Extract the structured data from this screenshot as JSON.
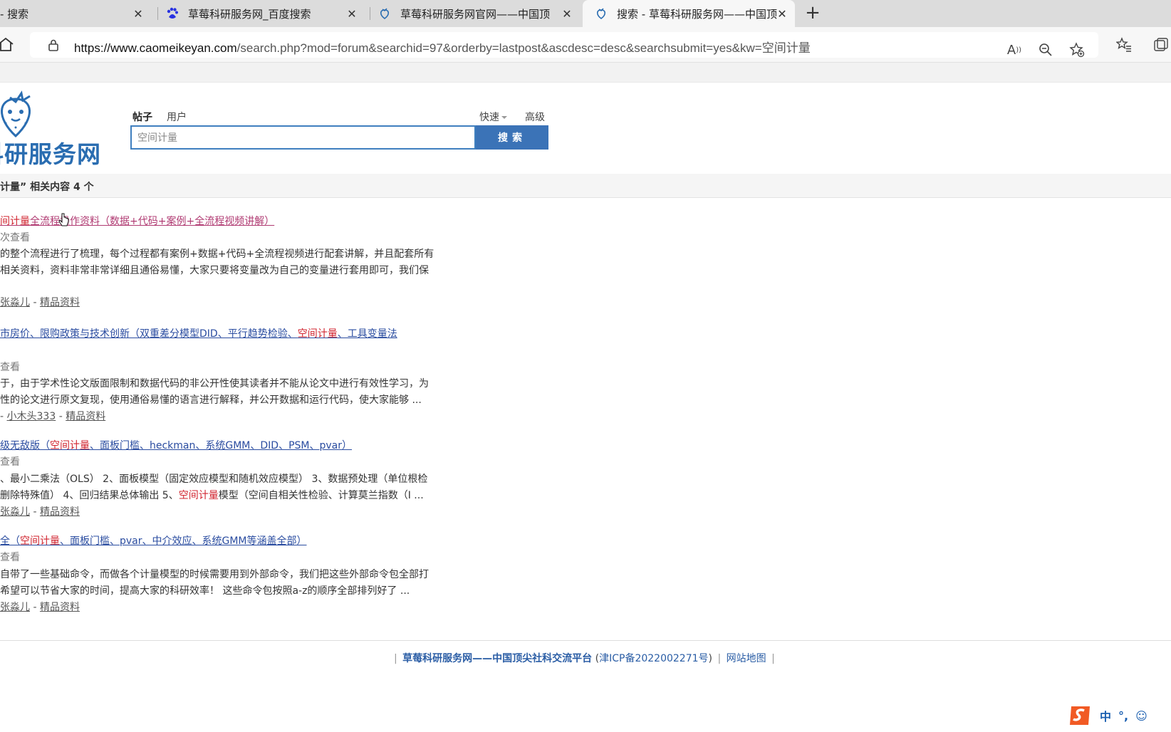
{
  "browser": {
    "tabs": [
      {
        "label": "- 搜索",
        "icon": "page-icon"
      },
      {
        "label": "草莓科研服务网_百度搜索",
        "icon": "baidu-paw-icon"
      },
      {
        "label": "草莓科研服务网官网——中国顶",
        "icon": "strawberry-icon"
      },
      {
        "label": "搜索 - 草莓科研服务网——中国顶",
        "icon": "strawberry-icon",
        "active": true
      }
    ],
    "address": {
      "host": "https://www.caomeikeyan.com",
      "path": "/search.php?mod=forum&searchid=97&orderby=lastpost&ascdesc=desc&searchsubmit=yes&kw=空间计量"
    }
  },
  "header": {
    "logo_text": "科研服务网",
    "search_types": [
      "帖子",
      "用户"
    ],
    "quick_label": "快速",
    "advanced_label": "高级",
    "search_value": "空间计量",
    "search_button": "搜索"
  },
  "summary": "计量” 相关内容 4 个",
  "results": [
    {
      "title_hl": "间计量",
      "title_rest": "全流程操作资料（数据+代码+案例+全流程视频讲解）",
      "meta": "次查看",
      "line1": "的整个流程进行了梳理，每个过程都有案例+数据+代码+全流程视频进行配套讲解，并且配套所有",
      "line2": "相关资料，资料非常非常详细且通俗易懂，大家只要将变量改为自己的变量进行套用即可，我们保",
      "author": "张淼儿",
      "category": "精品资料"
    },
    {
      "title_pre": "市房价、限购政策与技术创新（双重差分模型DID、平行趋势检验、",
      "title_hl": "空间计量",
      "title_post": "、工具变量法",
      "meta": "查看",
      "line1": "于，由于学术性论文版面限制和数据代码的非公开性使其读者并不能从论文中进行有效性学习，为",
      "line2": "性的论文进行原文复现，使用通俗易懂的语言进行解释，并公开数据和运行代码，使大家能够 ...",
      "author": "小木头333",
      "category": "精品资料"
    },
    {
      "title_pre": "级无敌版（",
      "title_hl": "空间计量",
      "title_post": "、面板门槛、heckman、系统GMM、DID、PSM、pvar）",
      "meta": "查看",
      "line1": "、最小二乘法（OLS） 2、面板模型（固定效应模型和随机效应模型） 3、数据预处理（单位根检",
      "line2_pre": "删除特殊值） 4、回归结果总体输出 5、",
      "line2_hl": "空间计量",
      "line2_post": "模型（空间自相关性检验、计算莫兰指数（I ...",
      "author": "张淼儿",
      "category": "精品资料"
    },
    {
      "title_pre": "全（",
      "title_hl": "空间计量",
      "title_post": "、面板门槛、pvar、中介效应、系统GMM等涵盖全部）",
      "meta": "查看",
      "line1": "自带了一些基础命令，而做各个计量模型的时候需要用到外部命令，我们把这些外部命令包全部打",
      "line2": "希望可以节省大家的时间，提高大家的科研效率！ 这些命令包按照a-z的顺序全部排列好了 ...",
      "author": "张淼儿",
      "category": "精品资料"
    }
  ],
  "footer": {
    "site": "草莓科研服务网——中国顶尖社科交流平台",
    "icp": "津ICP备2022002271号",
    "sitemap": "网站地图"
  },
  "ime": {
    "mode": "中",
    "punct": "°,"
  }
}
